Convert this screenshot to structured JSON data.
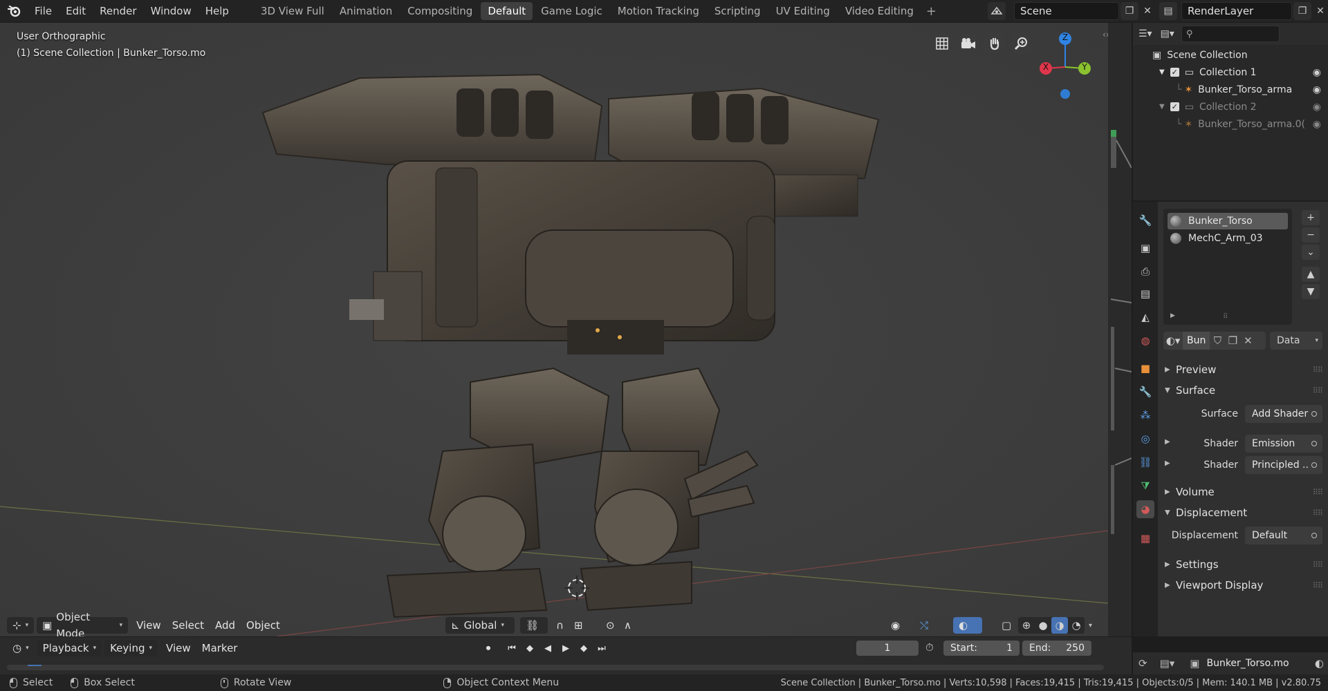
{
  "topbar": {
    "menus": [
      "File",
      "Edit",
      "Render",
      "Window",
      "Help"
    ],
    "workspaces": [
      "3D View Full",
      "Animation",
      "Compositing",
      "Default",
      "Game Logic",
      "Motion Tracking",
      "Scripting",
      "UV Editing",
      "Video Editing"
    ],
    "active_workspace": "Default",
    "add_label": "+",
    "scene_name": "Scene",
    "render_layer": "RenderLayer"
  },
  "viewport": {
    "view_name": "User Orthographic",
    "collection_info": "(1) Scene Collection | Bunker_Torso.mo",
    "gizmo_axes": {
      "x": "X",
      "y": "Y",
      "z": "Z"
    },
    "header": {
      "mode": "Object Mode",
      "menus": [
        "View",
        "Select",
        "Add",
        "Object"
      ],
      "orientation": "Global"
    }
  },
  "outliner": {
    "root": "Scene Collection",
    "rows": [
      {
        "label": "Collection 1",
        "type": "collection",
        "dim": false
      },
      {
        "label": "Bunker_Torso_arma",
        "type": "armature",
        "dim": false
      },
      {
        "label": "Collection 2",
        "type": "collection",
        "dim": true
      },
      {
        "label": "Bunker_Torso_arma.0(",
        "type": "armature",
        "dim": true
      }
    ]
  },
  "properties": {
    "materials": [
      "Bunker_Torso",
      "MechC_Arm_03"
    ],
    "selected_material": "Bunker_Torso",
    "slot_name": "Bun",
    "link_mode": "Data",
    "panels": {
      "preview": "Preview",
      "surface": "Surface",
      "volume": "Volume",
      "displacement": "Displacement",
      "settings": "Settings",
      "viewport_display": "Viewport Display"
    },
    "surface_label": "Surface",
    "surface_value": "Add Shader",
    "shader_label": "Shader",
    "shader1_value": "Emission",
    "shader2_value": "Principled ..",
    "displacement_label": "Displacement",
    "displacement_value": "Default",
    "footer_object": "Bunker_Torso.mo"
  },
  "timeline": {
    "menus": [
      "Playback",
      "Keying",
      "View",
      "Marker"
    ],
    "current_frame": "1",
    "start_label": "Start:",
    "start": "1",
    "end_label": "End:",
    "end": "250"
  },
  "statusbar": {
    "select": "Select",
    "box_select": "Box Select",
    "rotate_view": "Rotate View",
    "context_menu": "Object Context Menu",
    "stats": "Scene Collection | Bunker_Torso.mo | Verts:10,598 | Faces:19,415 | Tris:19,415 | Objects:0/5 | Mem: 140.1 MB | v2.80.75"
  },
  "colors": {
    "accent": "#4772b3",
    "viewport_bg": "#3d3d3d",
    "axis_x": "#e0364b",
    "axis_y": "#8bc22e",
    "axis_z": "#2f84e3"
  }
}
